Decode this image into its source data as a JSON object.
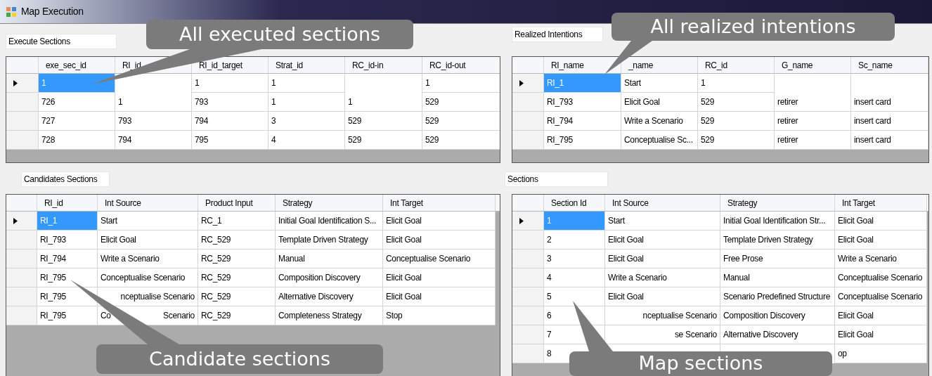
{
  "window": {
    "title": "Map Execution"
  },
  "execute_sections": {
    "label": "Execute Sections",
    "columns": [
      "exe_sec_id",
      "RI_id",
      "RI_id_target",
      "Strat_id",
      "RC_id-in",
      "RC_id-out"
    ],
    "rows": [
      {
        "current": true,
        "cells": [
          "1",
          "",
          "1",
          "1",
          "",
          "1"
        ]
      },
      {
        "current": false,
        "cells": [
          "726",
          "1",
          "793",
          "1",
          "1",
          "529"
        ]
      },
      {
        "current": false,
        "cells": [
          "727",
          "793",
          "794",
          "3",
          "529",
          "529"
        ]
      },
      {
        "current": false,
        "cells": [
          "728",
          "794",
          "795",
          "4",
          "529",
          "529"
        ]
      }
    ]
  },
  "realized_intentions": {
    "label": "Realized Intentions",
    "columns": [
      "RI_name",
      "_name",
      "RC_id",
      "G_name",
      "Sc_name"
    ],
    "rows": [
      {
        "current": true,
        "cells": [
          "RI_1",
          "Start",
          "1",
          "",
          ""
        ]
      },
      {
        "current": false,
        "cells": [
          "RI_793",
          "Elicit Goal",
          "529",
          "retirer",
          "insert card"
        ]
      },
      {
        "current": false,
        "cells": [
          "RI_794",
          "Write a Scenario",
          "529",
          "retirer",
          "insert card"
        ]
      },
      {
        "current": false,
        "cells": [
          "RI_795",
          "Conceptualise Sc...",
          "529",
          "retirer",
          "insert card"
        ]
      }
    ]
  },
  "candidates_sections": {
    "label": "Candidates Sections",
    "columns": [
      "RI_id",
      "Int Source",
      "Product Input",
      "Strategy",
      "Int Target"
    ],
    "rows": [
      {
        "current": true,
        "cells": [
          "RI_1",
          "Start",
          "RC_1",
          "Initial Goal Identification S...",
          "Elicit Goal"
        ]
      },
      {
        "current": false,
        "cells": [
          "RI_793",
          "Elicit Goal",
          "RC_529",
          "Template Driven Strategy",
          "Elicit Goal"
        ]
      },
      {
        "current": false,
        "cells": [
          "RI_794",
          "Write a Scenario",
          "RC_529",
          "Manual",
          "Conceptualise Scenario"
        ]
      },
      {
        "current": false,
        "cells": [
          "RI_795",
          "Conceptualise Scenario",
          "RC_529",
          "Composition Discovery",
          "Elicit Goal"
        ]
      },
      {
        "current": false,
        "cells": [
          "RI_795",
          {
            "parts": [
              "nceptualise Scenario"
            ]
          },
          "RC_529",
          "Alternative Discovery",
          "Elicit Goal"
        ]
      },
      {
        "current": false,
        "cells": [
          "RI_795",
          {
            "parts": [
              "Co",
              "Scenario"
            ]
          },
          "RC_529",
          "Completeness Strategy",
          "Stop"
        ]
      }
    ]
  },
  "sections": {
    "label": "Sections",
    "columns": [
      "Section Id",
      "Int Source",
      "Strategy",
      "Int Target"
    ],
    "rows": [
      {
        "current": true,
        "cells": [
          "1",
          "Start",
          "Initial Goal Identification Str...",
          "Elicit Goal"
        ]
      },
      {
        "current": false,
        "cells": [
          "2",
          "Elicit Goal",
          "Template Driven Strategy",
          "Elicit Goal"
        ]
      },
      {
        "current": false,
        "cells": [
          "3",
          "Elicit Goal",
          "Free Prose",
          "Write a Scenario"
        ]
      },
      {
        "current": false,
        "cells": [
          "4",
          "Write a Scenario",
          "Manual",
          "Conceptualise Scenario"
        ]
      },
      {
        "current": false,
        "cells": [
          "5",
          "Elicit Goal",
          "Scenario Predefined Structure",
          "Conceptualise Scenario"
        ]
      },
      {
        "current": false,
        "cells": [
          "6",
          {
            "parts": [
              "nceptualise Scenario"
            ]
          },
          "Composition Discovery",
          "Elicit Goal"
        ]
      },
      {
        "current": false,
        "cells": [
          "7",
          {
            "parts": [
              "se Scenario"
            ]
          },
          "Alternative Discovery",
          "Elicit Goal"
        ]
      },
      {
        "current": false,
        "cells": [
          "8",
          "",
          "",
          "op"
        ]
      }
    ]
  },
  "callouts": [
    "All executed sections",
    "All realized intentions",
    "Candidate sections",
    "Map sections"
  ]
}
